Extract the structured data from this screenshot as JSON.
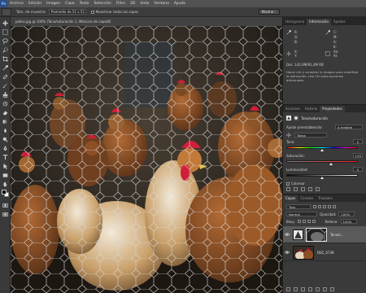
{
  "menubar": {
    "logo": "Ps",
    "items": [
      "Archivo",
      "Edición",
      "Imagen",
      "Capa",
      "Texto",
      "Selección",
      "Filtro",
      "3D",
      "Vista",
      "Ventana",
      "Ayuda"
    ]
  },
  "options": {
    "sample_size_label": "Tam. de muestra:",
    "sample_size_value": "Promedio de 51 x 51",
    "sample_label": "Muestrear todas las capas",
    "mask_button": "Mostrar..."
  },
  "document": {
    "tab_title": "pollos.jpg @ 100% (Tono/saturación 1, Máscara de capa/8)"
  },
  "panels": {
    "top_tabs": [
      "Histograma",
      "Información",
      "Ajustes"
    ],
    "active_top_tab": "Información",
    "info": {
      "r": "R:",
      "g": "G:",
      "b": "B:",
      "c": "C:",
      "m": "M:",
      "y": "A:",
      "k": "K:",
      "x": "X:",
      "y_pos": "Y:",
      "w": "An:",
      "h": "Al:",
      "doc": "Doc: 142,9M/91,4M RB",
      "hint": "Hacer clic y arrastrar la imagen para modificar la saturación. Use Ctrl para opciones adicionales."
    },
    "props_tabs": [
      "Acciones",
      "Historia",
      "Propiedades"
    ],
    "active_props_tab": "Propiedades",
    "props": {
      "title": "Tono/saturación",
      "preset_label": "Ajuste preestablecido:",
      "preset_value": "A medida",
      "channel_value": "Todos",
      "hue_label": "Tono:",
      "hue_value": "0",
      "hue_level": 0.5,
      "sat_label": "Saturación:",
      "sat_value": "+25",
      "sat_level": 0.62,
      "light_label": "Luminosidad:",
      "light_value": "0",
      "light_level": 0.5,
      "colorize_label": "Colorear"
    },
    "layers_tabs": [
      "Capas",
      "Canales",
      "Trazados"
    ],
    "active_layers_tab": "Capas",
    "layers": {
      "filter_label": "Tipo",
      "blend_mode": "Normal",
      "opacity_label": "Opacidad:",
      "opacity_value": "100%",
      "lock_label": "Bloq.:",
      "fill_label": "Relleno:",
      "fill_value": "100%",
      "items": [
        {
          "name": "Tono/s...",
          "type": "adjustment"
        },
        {
          "name": "DSC_0739",
          "type": "image"
        }
      ]
    }
  },
  "colors": {
    "ui_dark": "#2b2b2b",
    "menubar": "#535353",
    "panel": "#3a3a3a",
    "hen_red": "#cf1f38",
    "hen_brown": "#8c4f26"
  }
}
